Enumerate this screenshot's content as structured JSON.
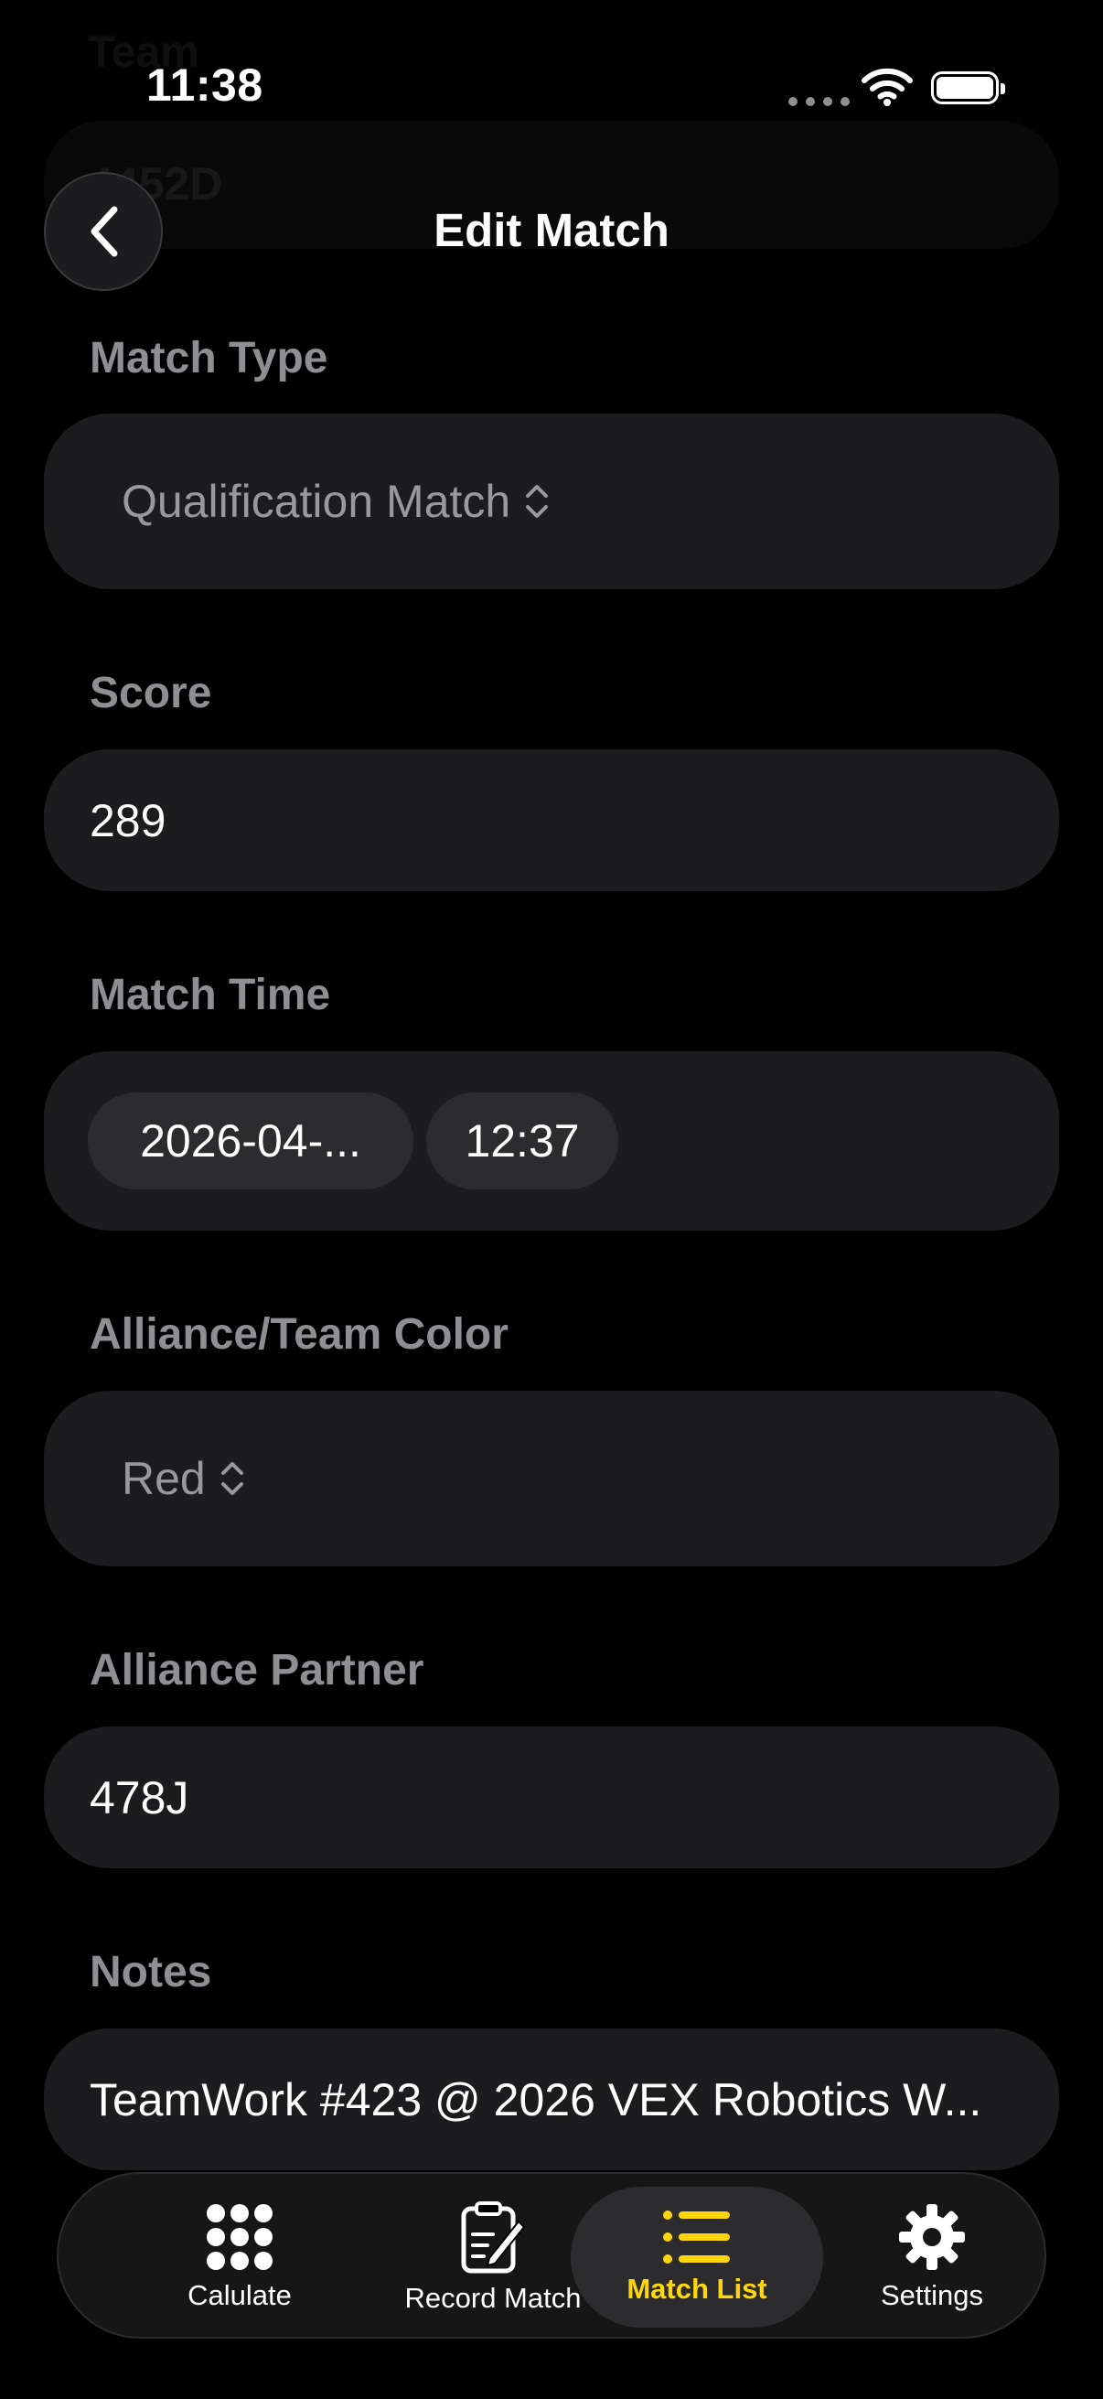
{
  "status_bar": {
    "time": "11:38"
  },
  "ghost": {
    "label": "Team",
    "value": "4452D"
  },
  "header": {
    "title": "Edit Match"
  },
  "form": {
    "match_type": {
      "label": "Match Type",
      "value": "Qualification Match"
    },
    "score": {
      "label": "Score",
      "value": "289"
    },
    "match_time": {
      "label": "Match Time",
      "date": "2026-04-...",
      "time": "12:37"
    },
    "alliance_color": {
      "label": "Alliance/Team Color",
      "value": "Red"
    },
    "alliance_partner": {
      "label": "Alliance Partner",
      "value": "478J"
    },
    "notes": {
      "label": "Notes",
      "value": "TeamWork #423 @ 2026 VEX Robotics W..."
    }
  },
  "tabbar": {
    "items": [
      {
        "label": "Calulate",
        "icon": "grid-icon",
        "active": false
      },
      {
        "label": "Record Match",
        "icon": "clipboard-pencil-icon",
        "active": false
      },
      {
        "label": "Match List",
        "icon": "list-icon",
        "active": true
      },
      {
        "label": "Settings",
        "icon": "gear-icon",
        "active": false
      }
    ],
    "accent_color": "#ffd60a"
  }
}
